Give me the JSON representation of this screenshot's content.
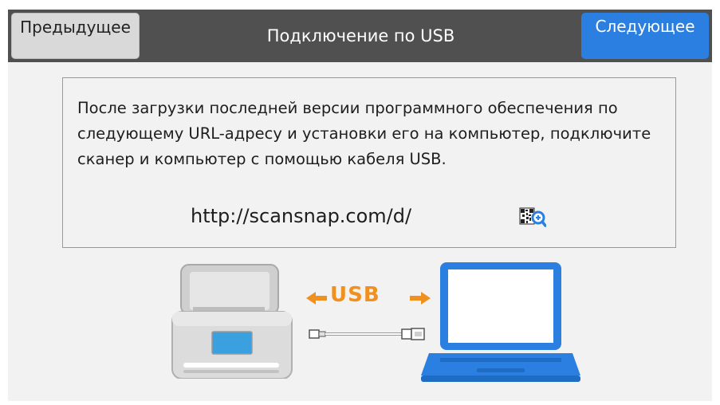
{
  "header": {
    "prev_label": "Предыдущее",
    "title": "Подключение по USB",
    "next_label": "Следующее"
  },
  "message": {
    "text": "После загрузки последней версии программного обеспечения по следующему URL-адресу и установки его на компьютер, подключите сканер и компьютер с помощью кабеля USB.",
    "url": "http://scansnap.com/d/"
  },
  "illustration": {
    "usb_label": "USB"
  },
  "colors": {
    "topbar": "#505050",
    "next_button": "#2a7fe0",
    "prev_button": "#d9d9d9",
    "usb_accent": "#f0901e",
    "laptop": "#2a7fe0"
  },
  "icons": {
    "qr": "qr-zoom-icon",
    "arrows": "double-arrow-icon"
  }
}
